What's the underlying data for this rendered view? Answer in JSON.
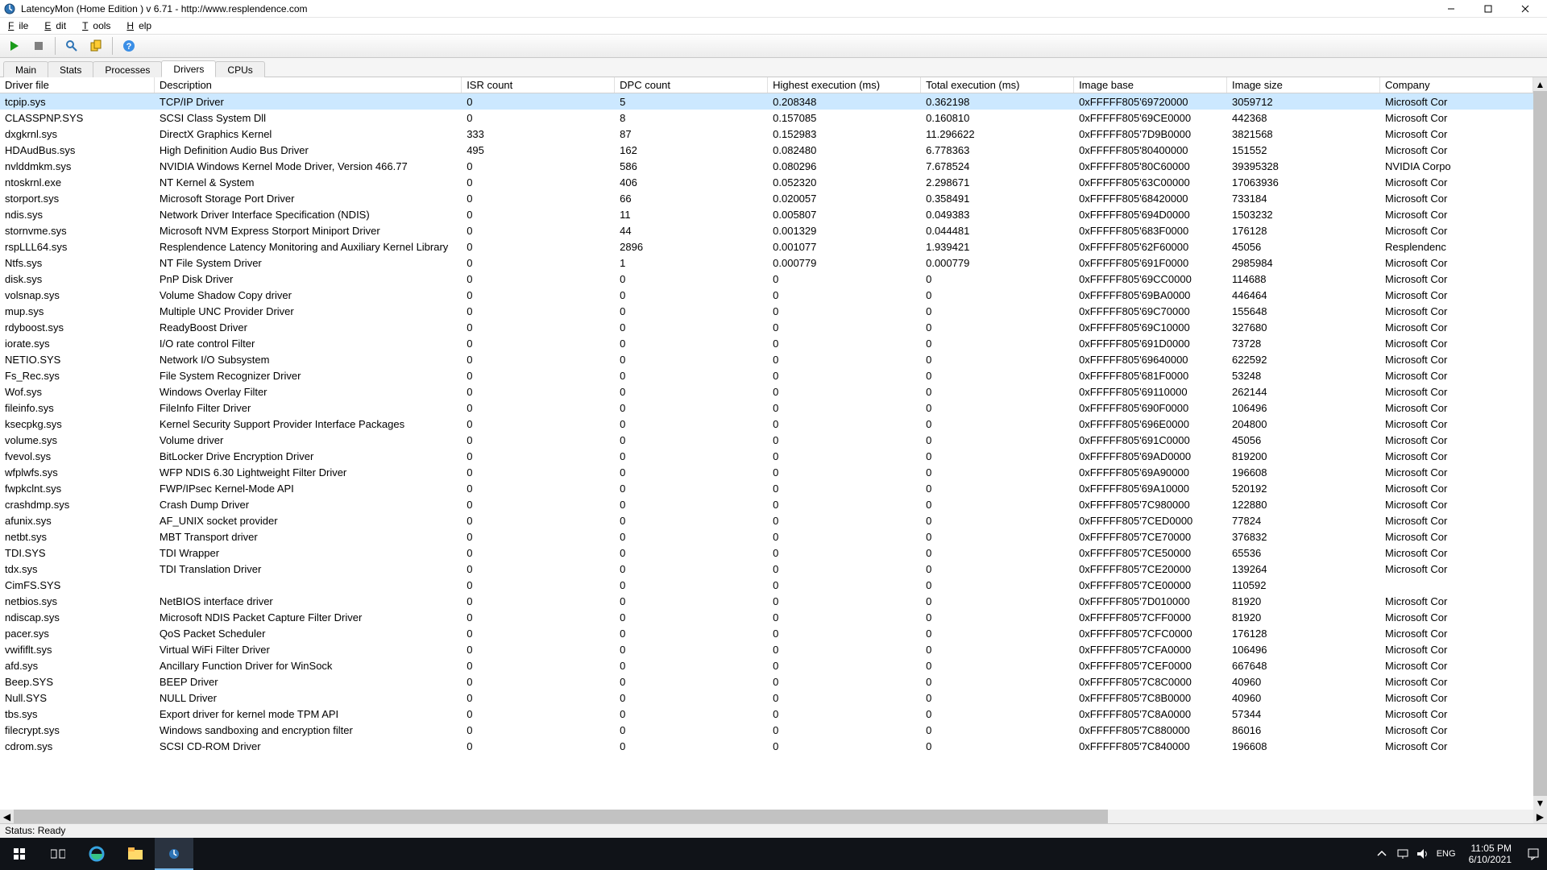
{
  "window": {
    "title": "LatencyMon  (Home Edition )  v 6.71 - http://www.resplendence.com"
  },
  "menubar": [
    "File",
    "Edit",
    "Tools",
    "Help"
  ],
  "tabs": [
    "Main",
    "Stats",
    "Processes",
    "Drivers",
    "CPUs"
  ],
  "active_tab": "Drivers",
  "status": "Status: Ready",
  "columns": [
    "Driver file",
    "Description",
    "ISR count",
    "DPC count",
    "Highest execution (ms)",
    "Total execution (ms)",
    "Image base",
    "Image size",
    "Company"
  ],
  "rows": [
    {
      "file": "tcpip.sys",
      "desc": "TCP/IP Driver",
      "isr": "0",
      "dpc": "5",
      "hex": "0.208348",
      "tex": "0.362198",
      "base": "0xFFFFF805'69720000",
      "size": "3059712",
      "co": "Microsoft Cor"
    },
    {
      "file": "CLASSPNP.SYS",
      "desc": "SCSI Class System Dll",
      "isr": "0",
      "dpc": "8",
      "hex": "0.157085",
      "tex": "0.160810",
      "base": "0xFFFFF805'69CE0000",
      "size": "442368",
      "co": "Microsoft Cor"
    },
    {
      "file": "dxgkrnl.sys",
      "desc": "DirectX Graphics Kernel",
      "isr": "333",
      "dpc": "87",
      "hex": "0.152983",
      "tex": "11.296622",
      "base": "0xFFFFF805'7D9B0000",
      "size": "3821568",
      "co": "Microsoft Cor"
    },
    {
      "file": "HDAudBus.sys",
      "desc": "High Definition Audio Bus Driver",
      "isr": "495",
      "dpc": "162",
      "hex": "0.082480",
      "tex": "6.778363",
      "base": "0xFFFFF805'80400000",
      "size": "151552",
      "co": "Microsoft Cor"
    },
    {
      "file": "nvlddmkm.sys",
      "desc": "NVIDIA Windows Kernel Mode Driver, Version 466.77",
      "isr": "0",
      "dpc": "586",
      "hex": "0.080296",
      "tex": "7.678524",
      "base": "0xFFFFF805'80C60000",
      "size": "39395328",
      "co": "NVIDIA Corpo"
    },
    {
      "file": "ntoskrnl.exe",
      "desc": "NT Kernel & System",
      "isr": "0",
      "dpc": "406",
      "hex": "0.052320",
      "tex": "2.298671",
      "base": "0xFFFFF805'63C00000",
      "size": "17063936",
      "co": "Microsoft Cor"
    },
    {
      "file": "storport.sys",
      "desc": "Microsoft Storage Port Driver",
      "isr": "0",
      "dpc": "66",
      "hex": "0.020057",
      "tex": "0.358491",
      "base": "0xFFFFF805'68420000",
      "size": "733184",
      "co": "Microsoft Cor"
    },
    {
      "file": "ndis.sys",
      "desc": "Network Driver Interface Specification (NDIS)",
      "isr": "0",
      "dpc": "11",
      "hex": "0.005807",
      "tex": "0.049383",
      "base": "0xFFFFF805'694D0000",
      "size": "1503232",
      "co": "Microsoft Cor"
    },
    {
      "file": "stornvme.sys",
      "desc": "Microsoft NVM Express Storport Miniport Driver",
      "isr": "0",
      "dpc": "44",
      "hex": "0.001329",
      "tex": "0.044481",
      "base": "0xFFFFF805'683F0000",
      "size": "176128",
      "co": "Microsoft Cor"
    },
    {
      "file": "rspLLL64.sys",
      "desc": "Resplendence Latency Monitoring and Auxiliary Kernel Library",
      "isr": "0",
      "dpc": "2896",
      "hex": "0.001077",
      "tex": "1.939421",
      "base": "0xFFFFF805'62F60000",
      "size": "45056",
      "co": "Resplendenc"
    },
    {
      "file": "Ntfs.sys",
      "desc": "NT File System Driver",
      "isr": "0",
      "dpc": "1",
      "hex": "0.000779",
      "tex": "0.000779",
      "base": "0xFFFFF805'691F0000",
      "size": "2985984",
      "co": "Microsoft Cor"
    },
    {
      "file": "disk.sys",
      "desc": "PnP Disk Driver",
      "isr": "0",
      "dpc": "0",
      "hex": "0",
      "tex": "0",
      "base": "0xFFFFF805'69CC0000",
      "size": "114688",
      "co": "Microsoft Cor"
    },
    {
      "file": "volsnap.sys",
      "desc": "Volume Shadow Copy driver",
      "isr": "0",
      "dpc": "0",
      "hex": "0",
      "tex": "0",
      "base": "0xFFFFF805'69BA0000",
      "size": "446464",
      "co": "Microsoft Cor"
    },
    {
      "file": "mup.sys",
      "desc": "Multiple UNC Provider Driver",
      "isr": "0",
      "dpc": "0",
      "hex": "0",
      "tex": "0",
      "base": "0xFFFFF805'69C70000",
      "size": "155648",
      "co": "Microsoft Cor"
    },
    {
      "file": "rdyboost.sys",
      "desc": "ReadyBoost Driver",
      "isr": "0",
      "dpc": "0",
      "hex": "0",
      "tex": "0",
      "base": "0xFFFFF805'69C10000",
      "size": "327680",
      "co": "Microsoft Cor"
    },
    {
      "file": "iorate.sys",
      "desc": "I/O rate control Filter",
      "isr": "0",
      "dpc": "0",
      "hex": "0",
      "tex": "0",
      "base": "0xFFFFF805'691D0000",
      "size": "73728",
      "co": "Microsoft Cor"
    },
    {
      "file": "NETIO.SYS",
      "desc": "Network I/O Subsystem",
      "isr": "0",
      "dpc": "0",
      "hex": "0",
      "tex": "0",
      "base": "0xFFFFF805'69640000",
      "size": "622592",
      "co": "Microsoft Cor"
    },
    {
      "file": "Fs_Rec.sys",
      "desc": "File System Recognizer Driver",
      "isr": "0",
      "dpc": "0",
      "hex": "0",
      "tex": "0",
      "base": "0xFFFFF805'681F0000",
      "size": "53248",
      "co": "Microsoft Cor"
    },
    {
      "file": "Wof.sys",
      "desc": "Windows Overlay Filter",
      "isr": "0",
      "dpc": "0",
      "hex": "0",
      "tex": "0",
      "base": "0xFFFFF805'69110000",
      "size": "262144",
      "co": "Microsoft Cor"
    },
    {
      "file": "fileinfo.sys",
      "desc": "FileInfo Filter Driver",
      "isr": "0",
      "dpc": "0",
      "hex": "0",
      "tex": "0",
      "base": "0xFFFFF805'690F0000",
      "size": "106496",
      "co": "Microsoft Cor"
    },
    {
      "file": "ksecpkg.sys",
      "desc": "Kernel Security Support Provider Interface Packages",
      "isr": "0",
      "dpc": "0",
      "hex": "0",
      "tex": "0",
      "base": "0xFFFFF805'696E0000",
      "size": "204800",
      "co": "Microsoft Cor"
    },
    {
      "file": "volume.sys",
      "desc": "Volume driver",
      "isr": "0",
      "dpc": "0",
      "hex": "0",
      "tex": "0",
      "base": "0xFFFFF805'691C0000",
      "size": "45056",
      "co": "Microsoft Cor"
    },
    {
      "file": "fvevol.sys",
      "desc": "BitLocker Drive Encryption Driver",
      "isr": "0",
      "dpc": "0",
      "hex": "0",
      "tex": "0",
      "base": "0xFFFFF805'69AD0000",
      "size": "819200",
      "co": "Microsoft Cor"
    },
    {
      "file": "wfplwfs.sys",
      "desc": "WFP NDIS 6.30 Lightweight Filter Driver",
      "isr": "0",
      "dpc": "0",
      "hex": "0",
      "tex": "0",
      "base": "0xFFFFF805'69A90000",
      "size": "196608",
      "co": "Microsoft Cor"
    },
    {
      "file": "fwpkclnt.sys",
      "desc": "FWP/IPsec Kernel-Mode API",
      "isr": "0",
      "dpc": "0",
      "hex": "0",
      "tex": "0",
      "base": "0xFFFFF805'69A10000",
      "size": "520192",
      "co": "Microsoft Cor"
    },
    {
      "file": "crashdmp.sys",
      "desc": "Crash Dump Driver",
      "isr": "0",
      "dpc": "0",
      "hex": "0",
      "tex": "0",
      "base": "0xFFFFF805'7C980000",
      "size": "122880",
      "co": "Microsoft Cor"
    },
    {
      "file": "afunix.sys",
      "desc": "AF_UNIX socket provider",
      "isr": "0",
      "dpc": "0",
      "hex": "0",
      "tex": "0",
      "base": "0xFFFFF805'7CED0000",
      "size": "77824",
      "co": "Microsoft Cor"
    },
    {
      "file": "netbt.sys",
      "desc": "MBT Transport driver",
      "isr": "0",
      "dpc": "0",
      "hex": "0",
      "tex": "0",
      "base": "0xFFFFF805'7CE70000",
      "size": "376832",
      "co": "Microsoft Cor"
    },
    {
      "file": "TDI.SYS",
      "desc": "TDI Wrapper",
      "isr": "0",
      "dpc": "0",
      "hex": "0",
      "tex": "0",
      "base": "0xFFFFF805'7CE50000",
      "size": "65536",
      "co": "Microsoft Cor"
    },
    {
      "file": "tdx.sys",
      "desc": "TDI Translation Driver",
      "isr": "0",
      "dpc": "0",
      "hex": "0",
      "tex": "0",
      "base": "0xFFFFF805'7CE20000",
      "size": "139264",
      "co": "Microsoft Cor"
    },
    {
      "file": "CimFS.SYS",
      "desc": "",
      "isr": "0",
      "dpc": "0",
      "hex": "0",
      "tex": "0",
      "base": "0xFFFFF805'7CE00000",
      "size": "110592",
      "co": ""
    },
    {
      "file": "netbios.sys",
      "desc": "NetBIOS interface driver",
      "isr": "0",
      "dpc": "0",
      "hex": "0",
      "tex": "0",
      "base": "0xFFFFF805'7D010000",
      "size": "81920",
      "co": "Microsoft Cor"
    },
    {
      "file": "ndiscap.sys",
      "desc": "Microsoft NDIS Packet Capture Filter Driver",
      "isr": "0",
      "dpc": "0",
      "hex": "0",
      "tex": "0",
      "base": "0xFFFFF805'7CFF0000",
      "size": "81920",
      "co": "Microsoft Cor"
    },
    {
      "file": "pacer.sys",
      "desc": "QoS Packet Scheduler",
      "isr": "0",
      "dpc": "0",
      "hex": "0",
      "tex": "0",
      "base": "0xFFFFF805'7CFC0000",
      "size": "176128",
      "co": "Microsoft Cor"
    },
    {
      "file": "vwififlt.sys",
      "desc": "Virtual WiFi Filter Driver",
      "isr": "0",
      "dpc": "0",
      "hex": "0",
      "tex": "0",
      "base": "0xFFFFF805'7CFA0000",
      "size": "106496",
      "co": "Microsoft Cor"
    },
    {
      "file": "afd.sys",
      "desc": "Ancillary Function Driver for WinSock",
      "isr": "0",
      "dpc": "0",
      "hex": "0",
      "tex": "0",
      "base": "0xFFFFF805'7CEF0000",
      "size": "667648",
      "co": "Microsoft Cor"
    },
    {
      "file": "Beep.SYS",
      "desc": "BEEP Driver",
      "isr": "0",
      "dpc": "0",
      "hex": "0",
      "tex": "0",
      "base": "0xFFFFF805'7C8C0000",
      "size": "40960",
      "co": "Microsoft Cor"
    },
    {
      "file": "Null.SYS",
      "desc": "NULL Driver",
      "isr": "0",
      "dpc": "0",
      "hex": "0",
      "tex": "0",
      "base": "0xFFFFF805'7C8B0000",
      "size": "40960",
      "co": "Microsoft Cor"
    },
    {
      "file": "tbs.sys",
      "desc": "Export driver for kernel mode TPM API",
      "isr": "0",
      "dpc": "0",
      "hex": "0",
      "tex": "0",
      "base": "0xFFFFF805'7C8A0000",
      "size": "57344",
      "co": "Microsoft Cor"
    },
    {
      "file": "filecrypt.sys",
      "desc": "Windows sandboxing and encryption filter",
      "isr": "0",
      "dpc": "0",
      "hex": "0",
      "tex": "0",
      "base": "0xFFFFF805'7C880000",
      "size": "86016",
      "co": "Microsoft Cor"
    },
    {
      "file": "cdrom.sys",
      "desc": "SCSI CD-ROM Driver",
      "isr": "0",
      "dpc": "0",
      "hex": "0",
      "tex": "0",
      "base": "0xFFFFF805'7C840000",
      "size": "196608",
      "co": "Microsoft Cor"
    }
  ],
  "tray": {
    "lang": "ENG",
    "time": "11:05 PM",
    "date": "6/10/2021"
  }
}
